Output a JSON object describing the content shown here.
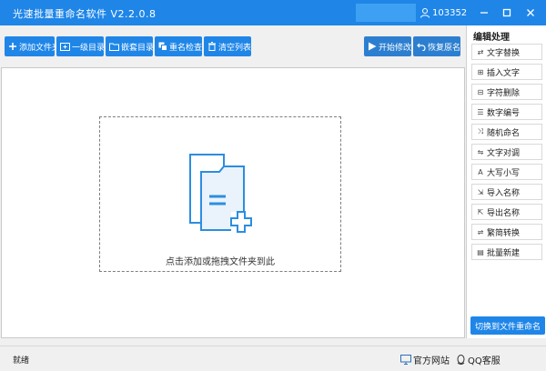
{
  "window": {
    "title": "光速批量重命名软件 V2.2.0.8",
    "user_id": "103352"
  },
  "toolbar": {
    "add_folder": "添加文件夹",
    "level1_dir": "一级目录",
    "nested_dir": "嵌套目录",
    "dup_check": "重名检查",
    "clear_list": "清空列表",
    "start_modify": "开始修改",
    "restore_name": "恢复原名"
  },
  "main": {
    "drop_hint": "点击添加或拖拽文件夹到此"
  },
  "side": {
    "heading": "编辑处理",
    "items": [
      {
        "label": "文字替换",
        "icon": "swap-icon"
      },
      {
        "label": "插入文字",
        "icon": "insert-icon"
      },
      {
        "label": "字符删除",
        "icon": "delete-char-icon"
      },
      {
        "label": "数字编号",
        "icon": "number-icon"
      },
      {
        "label": "随机命名",
        "icon": "shuffle-icon"
      },
      {
        "label": "文字对调",
        "icon": "exchange-icon"
      },
      {
        "label": "大写小写",
        "icon": "case-icon"
      },
      {
        "label": "导入名称",
        "icon": "import-icon"
      },
      {
        "label": "导出名称",
        "icon": "export-icon"
      },
      {
        "label": "繁简转换",
        "icon": "convert-icon"
      },
      {
        "label": "批量新建",
        "icon": "new-doc-icon"
      }
    ],
    "switch_button": "切换到文件重命名"
  },
  "status": {
    "ready": "就绪",
    "website": "官方网站",
    "qq_service": "QQ客服"
  }
}
